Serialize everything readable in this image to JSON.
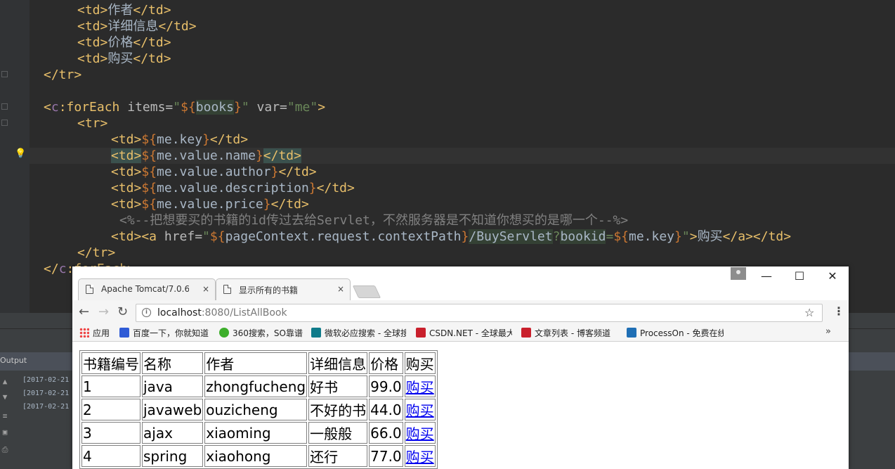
{
  "editor": {
    "lines": [
      {
        "indent": 4,
        "parts": [
          [
            "tg",
            "<td>"
          ],
          [
            "tx",
            "作者"
          ],
          [
            "tg",
            "</td>"
          ]
        ]
      },
      {
        "indent": 4,
        "parts": [
          [
            "tg",
            "<td>"
          ],
          [
            "tx",
            "详细信息"
          ],
          [
            "tg",
            "</td>"
          ]
        ]
      },
      {
        "indent": 4,
        "parts": [
          [
            "tg",
            "<td>"
          ],
          [
            "tx",
            "价格"
          ],
          [
            "tg",
            "</td>"
          ]
        ]
      },
      {
        "indent": 4,
        "parts": [
          [
            "tg",
            "<td>"
          ],
          [
            "tx",
            "购买"
          ],
          [
            "tg",
            "</td>"
          ]
        ]
      },
      {
        "indent": 0,
        "parts": [
          [
            "tg",
            "</tr>"
          ]
        ]
      },
      {
        "indent": 0,
        "parts": []
      },
      {
        "indent": 0,
        "parts": [
          [
            "tg",
            "<"
          ],
          [
            "ns",
            "c"
          ],
          [
            "tg",
            ":forEach "
          ],
          [
            "at",
            "items="
          ],
          [
            "st",
            "\""
          ],
          [
            "el",
            "${"
          ],
          [
            "hl",
            "books"
          ],
          [
            "el",
            "}"
          ],
          [
            "st",
            "\" "
          ],
          [
            "at",
            "var="
          ],
          [
            "st",
            "\"me\""
          ],
          [
            "tg",
            ">"
          ]
        ]
      },
      {
        "indent": 4,
        "parts": [
          [
            "tg",
            "<tr>"
          ]
        ]
      },
      {
        "indent": 8,
        "parts": [
          [
            "tg",
            "<td>"
          ],
          [
            "el",
            "${"
          ],
          [
            "tx",
            "me.key"
          ],
          [
            "el",
            "}"
          ],
          [
            "tg",
            "</td>"
          ]
        ]
      },
      {
        "indent": 8,
        "parts": [
          [
            "hlb",
            "<td>"
          ],
          [
            "el",
            "${"
          ],
          [
            "tx",
            "me.value.name"
          ],
          [
            "el",
            "}"
          ],
          [
            "hlb",
            "</td>"
          ]
        ]
      },
      {
        "indent": 8,
        "parts": [
          [
            "tg",
            "<td>"
          ],
          [
            "el",
            "${"
          ],
          [
            "tx",
            "me.value.author"
          ],
          [
            "el",
            "}"
          ],
          [
            "tg",
            "</td>"
          ]
        ]
      },
      {
        "indent": 8,
        "parts": [
          [
            "tg",
            "<td>"
          ],
          [
            "el",
            "${"
          ],
          [
            "tx",
            "me.value.description"
          ],
          [
            "el",
            "}"
          ],
          [
            "tg",
            "</td>"
          ]
        ]
      },
      {
        "indent": 8,
        "parts": [
          [
            "tg",
            "<td>"
          ],
          [
            "el",
            "${"
          ],
          [
            "tx",
            "me.value.price"
          ],
          [
            "el",
            "}"
          ],
          [
            "tg",
            "</td>"
          ]
        ]
      },
      {
        "indent": 9,
        "parts": [
          [
            "cm",
            "<%--把想要买的书籍的id传过去给Servlet，不然服务器是不知道你想买的是哪一个--%>"
          ]
        ]
      },
      {
        "indent": 8,
        "parts": [
          [
            "tg",
            "<td><a "
          ],
          [
            "at",
            "href="
          ],
          [
            "st",
            "\""
          ],
          [
            "el",
            "${"
          ],
          [
            "tx",
            "pageContext.request.contextPath"
          ],
          [
            "el",
            "}"
          ],
          [
            "hl",
            "/BuyServlet"
          ],
          [
            "st",
            "?"
          ],
          [
            "hl",
            "bookid"
          ],
          [
            "st",
            "="
          ],
          [
            "el",
            "${"
          ],
          [
            "tx",
            "me.key"
          ],
          [
            "el",
            "}"
          ],
          [
            "st",
            "\""
          ],
          [
            "tg",
            ">"
          ],
          [
            "tx",
            "购买"
          ],
          [
            "tg",
            "</a></td>"
          ]
        ]
      },
      {
        "indent": 4,
        "parts": [
          [
            "tg",
            "</tr>"
          ]
        ]
      },
      {
        "indent": 0,
        "parts": [
          [
            "tg",
            "</"
          ],
          [
            "ns",
            "c"
          ],
          [
            "tg",
            ":forEach>"
          ]
        ]
      }
    ]
  },
  "panel": {
    "output_label": "Output",
    "log": [
      "[2017-02-21",
      "[2017-02-21",
      "[2017-02-21"
    ]
  },
  "browser": {
    "tabs": [
      {
        "title": "Apache Tomcat/7.0.6",
        "close": "×"
      },
      {
        "title": "显示所有的书籍",
        "close": "×"
      }
    ],
    "window_buttons": {
      "minimize": "—",
      "maximize": "☐",
      "close": "✕"
    },
    "url_host": "localhost",
    "url_rest": ":8080/ListAllBook",
    "bookmarks": [
      {
        "label": "应用",
        "icon": "apps-icon",
        "color": "#e44"
      },
      {
        "label": "百度一下，你就知道",
        "icon": "baidu-icon",
        "color": "#2f5bd6"
      },
      {
        "label": "360搜索，SO靠谱",
        "icon": "so360-icon",
        "color": "#3dae2b"
      },
      {
        "label": "微软必应搜索 - 全球搜",
        "icon": "bing-icon",
        "color": "#0f7b8a"
      },
      {
        "label": "CSDN.NET - 全球最大",
        "icon": "csdn-icon",
        "color": "#c9202c"
      },
      {
        "label": "文章列表 - 博客频道",
        "icon": "csdn-blog-icon",
        "color": "#c9202c"
      },
      {
        "label": "ProcessOn - 免费在线",
        "icon": "processon-icon",
        "color": "#1f6fb5"
      }
    ],
    "more": "»",
    "table": {
      "headers": [
        "书籍编号",
        "名称",
        "作者",
        "详细信息",
        "价格",
        "购买"
      ],
      "rows": [
        [
          "1",
          "java",
          "zhongfucheng",
          "好书",
          "99.0",
          "购买"
        ],
        [
          "2",
          "javaweb",
          "ouzicheng",
          "不好的书",
          "44.0",
          "购买"
        ],
        [
          "3",
          "ajax",
          "xiaoming",
          "一般般",
          "66.0",
          "购买"
        ],
        [
          "4",
          "spring",
          "xiaohong",
          "还行",
          "77.0",
          "购买"
        ]
      ]
    }
  }
}
